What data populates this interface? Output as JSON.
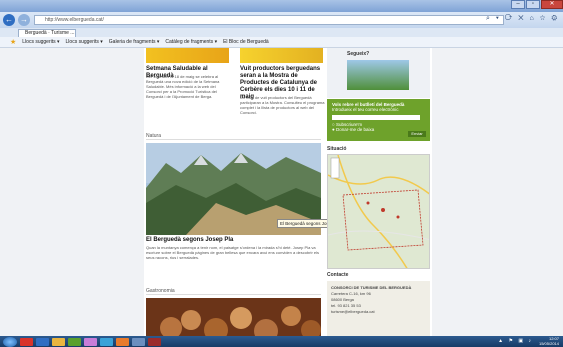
{
  "browser": {
    "address": "http://www.elbergueda.cat/",
    "tab_title": "Berguedà · Turisme ...",
    "favorites": [
      "Llocs suggerits ▾",
      "Llocs suggerits ▾",
      "Galeria de fragments ▾",
      "Catàleg de fragments ▾",
      "El Bloc de Berguedà"
    ]
  },
  "page": {
    "article1": {
      "title": "Setmana Saludable al Berguedà",
      "text": "Del 10 d'abril al 18 de maig se celebra al Berguedà una nova edició de la Setmana Saludable. Més informació a la web del Consorci per a la Promoció Turística del Berguedà i de l'Ajuntament de Berga."
    },
    "article2": {
      "title": "Vuit productors berguedans seran a la Mostra de Productes de Catalunya de Cerbère els dies 10 i 11 de maig",
      "text": "Un total de vuit productors del Berguedà participaran a la Mostra. Consulteu el programa complet i la llista de productors al web del Consorci."
    },
    "section_natura": "Natura",
    "natura_title": "El Berguedà segons Josep Pla",
    "natura_text": "Quan la muntanya comença a tenir nom, el paisatge s'ordena i la mirada s'hi deté. Josep Pla va escriure sobre el Berguedà pàgines de gran bellesa que encara avui ens conviden a descobrir els seus racons, rius i serralades.",
    "tooltip": "El Berguedà segons Josep Pla",
    "section_gastronomia": "Gastronomia",
    "sidebar": {
      "help_label": "Segueix?",
      "newsletter_title": "Vols rebre el butlletí del Berguedà",
      "newsletter_sub": "Introdueix el teu correu electrònic",
      "option1": "Subscriure'm",
      "option2": "Donar-me de baixa",
      "send": "Enviar",
      "map_label": "Situació",
      "contact_label": "Contacte",
      "contact_lines": [
        "CONSORCI DE TURISME DEL BERGUEDÀ",
        "Carretera C-16, km 96",
        "08600 Berga",
        "tel. 93 821 35 53",
        "turisme@elbergueda.cat"
      ]
    }
  },
  "taskbar": {
    "time": "12:07",
    "date": "15/05/2014"
  }
}
